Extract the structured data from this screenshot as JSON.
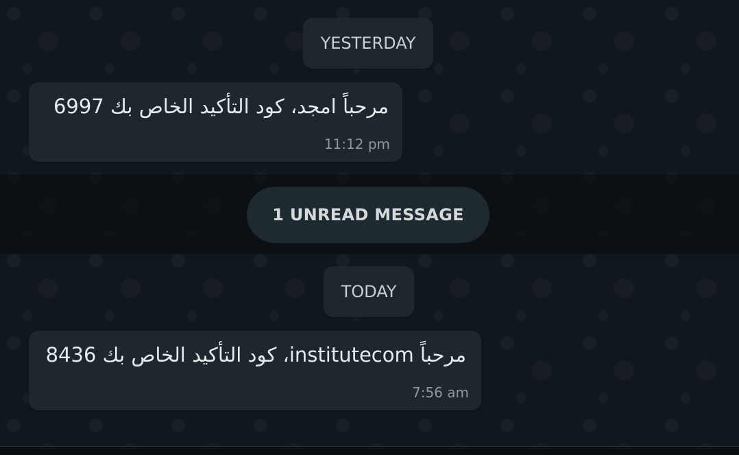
{
  "chat": {
    "date_yesterday": "YESTERDAY",
    "date_today": "TODAY",
    "unread_label": "1 UNREAD MESSAGE",
    "messages": [
      {
        "text": "مرحباً امجد، كود التأكيد الخاص بك 6997",
        "time": "11:12 pm"
      },
      {
        "text": "مرحباً institutecom، كود التأكيد الخاص بك 8436",
        "time": "7:56 am"
      }
    ]
  },
  "colors": {
    "background": "#11181d",
    "bubble": "#1e272d",
    "chip": "#1e272d",
    "text": "#e8ebed",
    "time": "#8f989e"
  }
}
